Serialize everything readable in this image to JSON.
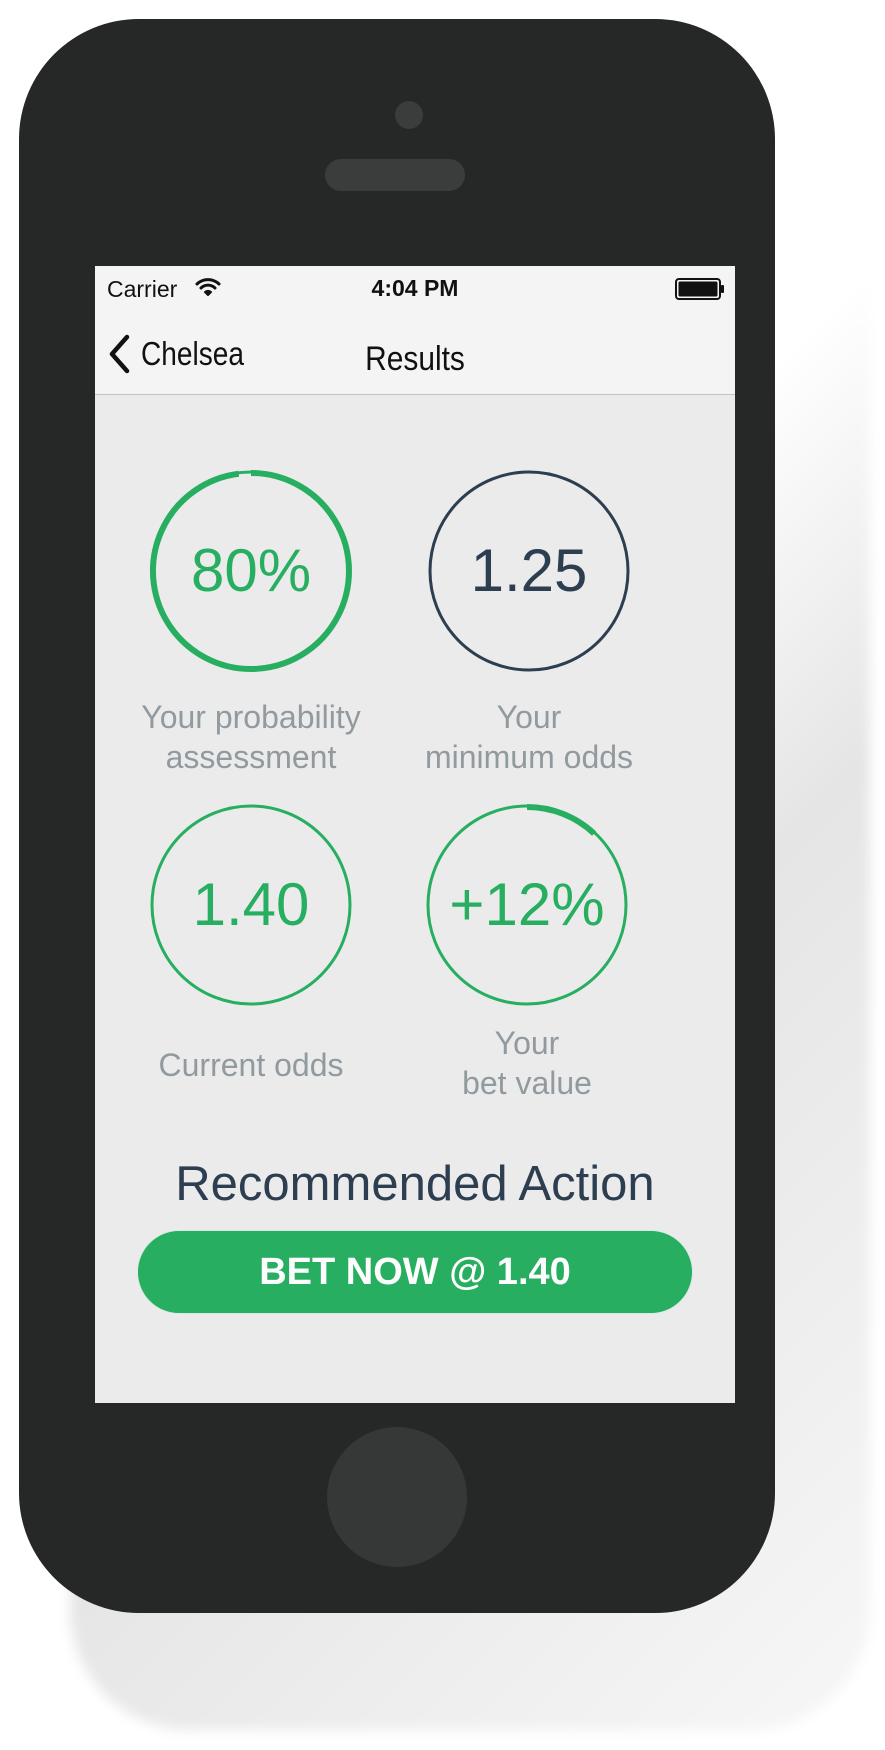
{
  "status_bar": {
    "carrier": "Carrier",
    "time": "4:04 PM",
    "wifi_icon": "wifi-icon",
    "battery_icon": "battery-icon"
  },
  "nav": {
    "back_label": "Chelsea",
    "back_icon": "chevron-left-icon",
    "title": "Results"
  },
  "metrics": [
    {
      "value": "80%",
      "label": "Your probability\nassessment",
      "color": "#27ae60",
      "progress": 0.98
    },
    {
      "value": "1.25",
      "label": "Your\nminimum odds",
      "color": "#2c3e50",
      "progress": 0
    },
    {
      "value": "1.40",
      "label": "Current odds",
      "color": "#27ae60",
      "progress": 0
    },
    {
      "value": "+12%",
      "label": "Your\nbet value",
      "color": "#27ae60",
      "progress": 0.12
    }
  ],
  "recommendation": {
    "title": "Recommended Action",
    "button_label": "BET NOW @ 1.40"
  },
  "colors": {
    "accent_green": "#27ae60",
    "dark_navy": "#2c3e50",
    "label_gray": "#919a9f",
    "screen_bg": "#ebebeb",
    "phone_body": "#262828"
  }
}
